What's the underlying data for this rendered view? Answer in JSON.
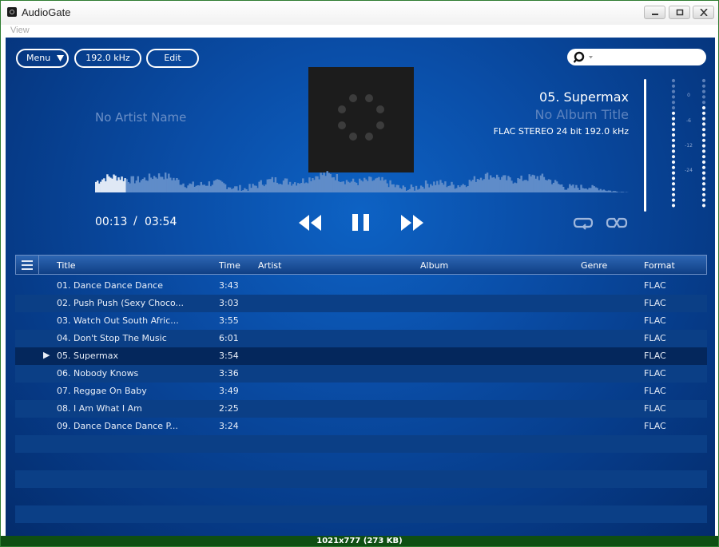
{
  "window": {
    "title": "AudioGate"
  },
  "menubar": {
    "view": "View"
  },
  "toolbar": {
    "menu_label": "Menu",
    "sample_rate": "192.0 kHz",
    "edit_label": "Edit",
    "search_placeholder": ""
  },
  "now_playing": {
    "artist": "No Artist Name",
    "title": "05. Supermax",
    "album": "No Album Title",
    "format_info": "FLAC STEREO 24 bit 192.0 kHz",
    "elapsed": "00:13",
    "separator": "/",
    "total": "03:54",
    "progress": 0.0556
  },
  "meter": {
    "scale": [
      "0",
      "-6",
      "-12",
      "-24"
    ]
  },
  "playlist": {
    "columns": {
      "title": "Title",
      "time": "Time",
      "artist": "Artist",
      "album": "Album",
      "genre": "Genre",
      "format": "Format"
    },
    "playing_marker": "▶",
    "rows": [
      {
        "title": "01. Dance Dance Dance",
        "time": "3:43",
        "artist": "",
        "album": "",
        "genre": "",
        "format": "FLAC",
        "playing": false
      },
      {
        "title": "02. Push Push (Sexy Choco...",
        "time": "3:03",
        "artist": "",
        "album": "",
        "genre": "",
        "format": "FLAC",
        "playing": false
      },
      {
        "title": "03. Watch Out South Afric...",
        "time": "3:55",
        "artist": "",
        "album": "",
        "genre": "",
        "format": "FLAC",
        "playing": false
      },
      {
        "title": "04. Don't Stop The Music",
        "time": "6:01",
        "artist": "",
        "album": "",
        "genre": "",
        "format": "FLAC",
        "playing": false
      },
      {
        "title": "05. Supermax",
        "time": "3:54",
        "artist": "",
        "album": "",
        "genre": "",
        "format": "FLAC",
        "playing": true
      },
      {
        "title": "06. Nobody Knows",
        "time": "3:36",
        "artist": "",
        "album": "",
        "genre": "",
        "format": "FLAC",
        "playing": false
      },
      {
        "title": "07. Reggae On Baby",
        "time": "3:49",
        "artist": "",
        "album": "",
        "genre": "",
        "format": "FLAC",
        "playing": false
      },
      {
        "title": "08. I Am What I Am",
        "time": "2:25",
        "artist": "",
        "album": "",
        "genre": "",
        "format": "FLAC",
        "playing": false
      },
      {
        "title": "09. Dance Dance Dance P...",
        "time": "3:24",
        "artist": "",
        "album": "",
        "genre": "",
        "format": "FLAC",
        "playing": false
      }
    ]
  },
  "statusbar": {
    "text": "1021x777 (273 KB)"
  },
  "colors": {
    "accent": "#0a4ea8",
    "window_border": "#2f7d31",
    "row_alt": "#0b3f86",
    "row_selected": "#04275c"
  },
  "icons": {
    "menu_arrow": "triangle-down-icon",
    "search": "search-icon",
    "rewind": "rewind-icon",
    "pause": "pause-icon",
    "fast_forward": "fast-forward-icon",
    "repeat": "repeat-icon",
    "shuffle": "shuffle-icon",
    "list": "hamburger-icon"
  }
}
